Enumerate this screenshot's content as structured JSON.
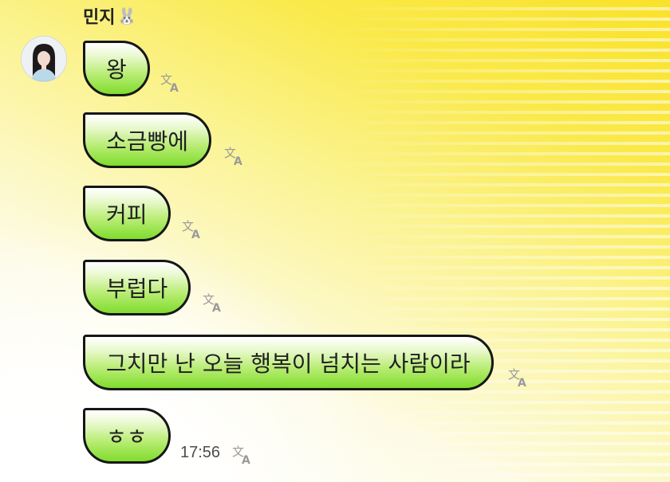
{
  "chat": {
    "sender_name": "민지",
    "sender_emoji": "🐰",
    "messages": [
      {
        "text": "왕"
      },
      {
        "text": "소금빵에"
      },
      {
        "text": "커피"
      },
      {
        "text": "부럽다"
      },
      {
        "text": "그치만 난 오늘 행복이 넘치는 사람이라"
      },
      {
        "text": "ㅎㅎ"
      }
    ],
    "last_timestamp": "17:56"
  },
  "colors": {
    "bubble_green": "#7fdc2d",
    "bubble_border": "#161616",
    "background_yellow": "#f9e22a"
  },
  "icons": {
    "translate": "translate-icon",
    "avatar": "profile-avatar"
  }
}
